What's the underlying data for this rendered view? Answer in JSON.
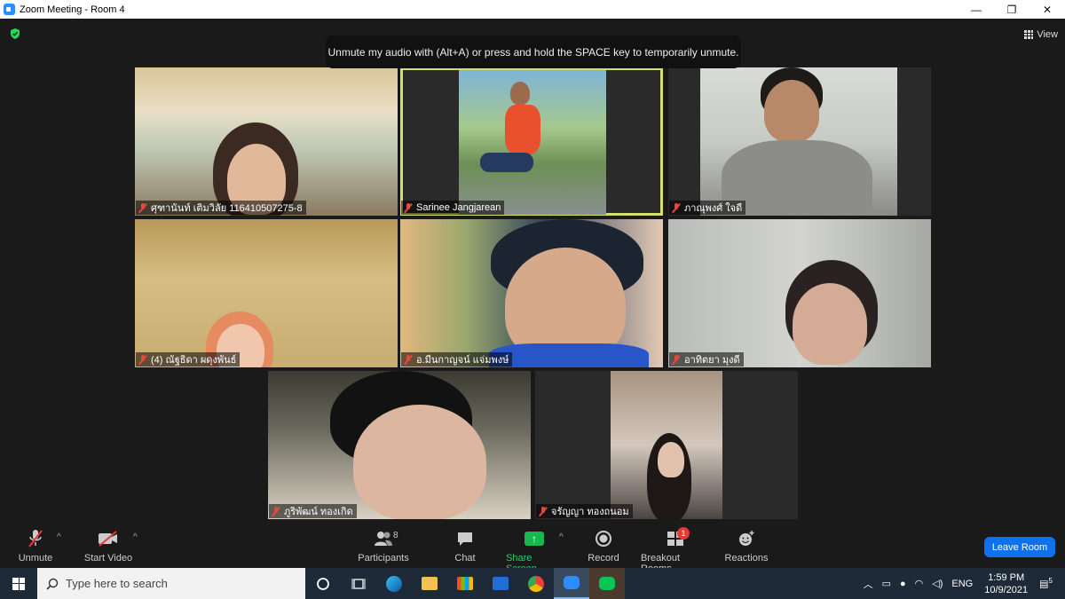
{
  "window": {
    "title": "Zoom Meeting - Room 4",
    "minimize": "—",
    "restore": "❐",
    "close": "✕",
    "view_label": "View"
  },
  "tooltip": "Unmute my audio with (Alt+A) or press and hold the SPACE key to temporarily unmute.",
  "participants": [
    {
      "name": "ศุฑานันท์ เติมวิลัย 116410507275-8"
    },
    {
      "name": "Sarinee Jangjarean"
    },
    {
      "name": "ภาณุพงศ์ ใจดี"
    },
    {
      "name": "(4) ณัฐธิดา ผดุงพันธ์"
    },
    {
      "name": "อ.มีนกาญจน์ แจ่มพงษ์"
    },
    {
      "name": "อาทิตยา มุงดี"
    },
    {
      "name": "ภูริพัฒน์ ทองเกิด"
    },
    {
      "name": "จรัญญา ทองถนอม"
    }
  ],
  "toolbar": {
    "unmute": "Unmute",
    "start_video": "Start Video",
    "participants": "Participants",
    "participants_count": "8",
    "chat": "Chat",
    "share_screen": "Share Screen",
    "record": "Record",
    "breakout_rooms": "Breakout Rooms",
    "breakout_badge": "1",
    "reactions": "Reactions",
    "leave_room": "Leave Room"
  },
  "taskbar": {
    "search_placeholder": "Type here to search",
    "language": "ENG",
    "time": "1:59 PM",
    "date": "10/9/2021",
    "notification_count": "5"
  },
  "colors": {
    "accent": "#0e72ed",
    "share_green": "#19b84e",
    "muted_red": "#e8483c",
    "active_speaker": "#d4e06b"
  }
}
